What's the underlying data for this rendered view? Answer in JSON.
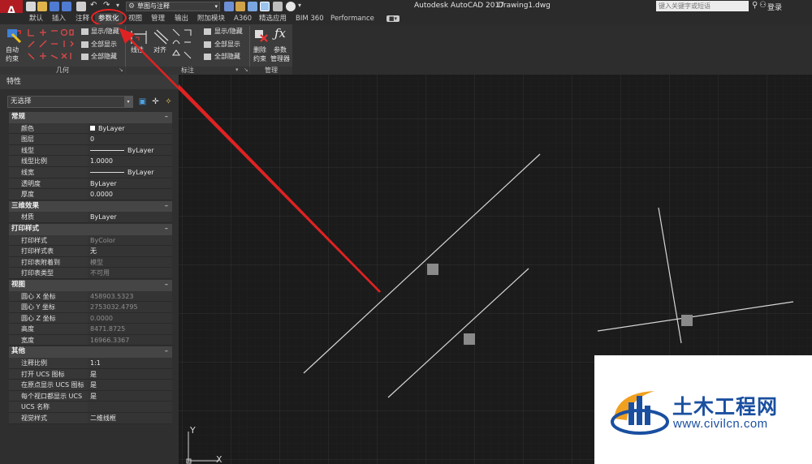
{
  "app": {
    "logo": "A",
    "title": "Autodesk AutoCAD 2017",
    "document": "Drawing1.dwg"
  },
  "toolbar": {
    "workspace": "草图与注释",
    "search_placeholder": "键入关键字或短语",
    "login": "登录"
  },
  "tabs": [
    "默认",
    "插入",
    "注释",
    "参数化",
    "视图",
    "管理",
    "输出",
    "附加模块",
    "A360",
    "精选应用",
    "BIM 360",
    "Performance"
  ],
  "active_tab": "参数化",
  "ribbon": {
    "geometry": {
      "auto_constrain_line1": "自动",
      "auto_constrain_line2": "约束",
      "show_hide": "显示/隐藏",
      "show_all": "全部显示",
      "hide_all": "全部隐藏",
      "panel": "几何"
    },
    "dimensional": {
      "linear": "线性",
      "aligned": "对齐",
      "show_hide": "显示/隐藏",
      "show_all": "全部显示",
      "hide_all": "全部隐藏",
      "panel": "标注"
    },
    "manage": {
      "delete_line1": "删除",
      "delete_line2": "约束",
      "params_line1": "参数",
      "params_line2": "管理器",
      "panel": "管理"
    }
  },
  "properties": {
    "title": "特性",
    "selection": "无选择",
    "sections": [
      {
        "name": "常规",
        "rows": [
          {
            "key": "颜色",
            "value": "ByLayer"
          },
          {
            "key": "图层",
            "value": "0"
          },
          {
            "key": "线型",
            "value": "ByLayer"
          },
          {
            "key": "线型比例",
            "value": "1.0000"
          },
          {
            "key": "线宽",
            "value": "ByLayer"
          },
          {
            "key": "透明度",
            "value": "ByLayer"
          },
          {
            "key": "厚度",
            "value": "0.0000"
          }
        ]
      },
      {
        "name": "三维效果",
        "rows": [
          {
            "key": "材质",
            "value": "ByLayer"
          }
        ]
      },
      {
        "name": "打印样式",
        "rows": [
          {
            "key": "打印样式",
            "value": "ByColor"
          },
          {
            "key": "打印样式表",
            "value": "无"
          },
          {
            "key": "打印表附着到",
            "value": "模型"
          },
          {
            "key": "打印表类型",
            "value": "不可用"
          }
        ]
      },
      {
        "name": "视图",
        "rows": [
          {
            "key": "圆心 X 坐标",
            "value": "458903.5323"
          },
          {
            "key": "圆心 Y 坐标",
            "value": "2753032.4795"
          },
          {
            "key": "圆心 Z 坐标",
            "value": "0.0000"
          },
          {
            "key": "高度",
            "value": "8471.8725"
          },
          {
            "key": "宽度",
            "value": "16966.3367"
          }
        ]
      },
      {
        "name": "其他",
        "rows": [
          {
            "key": "注释比例",
            "value": "1:1"
          },
          {
            "key": "打开 UCS 图标",
            "value": "是"
          },
          {
            "key": "在原点显示 UCS 图标",
            "value": "是"
          },
          {
            "key": "每个视口都显示 UCS",
            "value": "是"
          },
          {
            "key": "UCS 名称",
            "value": ""
          },
          {
            "key": "视觉样式",
            "value": "二维线框"
          }
        ]
      }
    ]
  },
  "ucs": {
    "y": "Y",
    "x": "X"
  },
  "watermark": {
    "title": "土木工程网",
    "url": "www.civilcn.com"
  },
  "colors": {
    "accent_red": "#e22222",
    "canvas": "#1b1b1b",
    "watermark_blue": "#1a4fa0"
  }
}
